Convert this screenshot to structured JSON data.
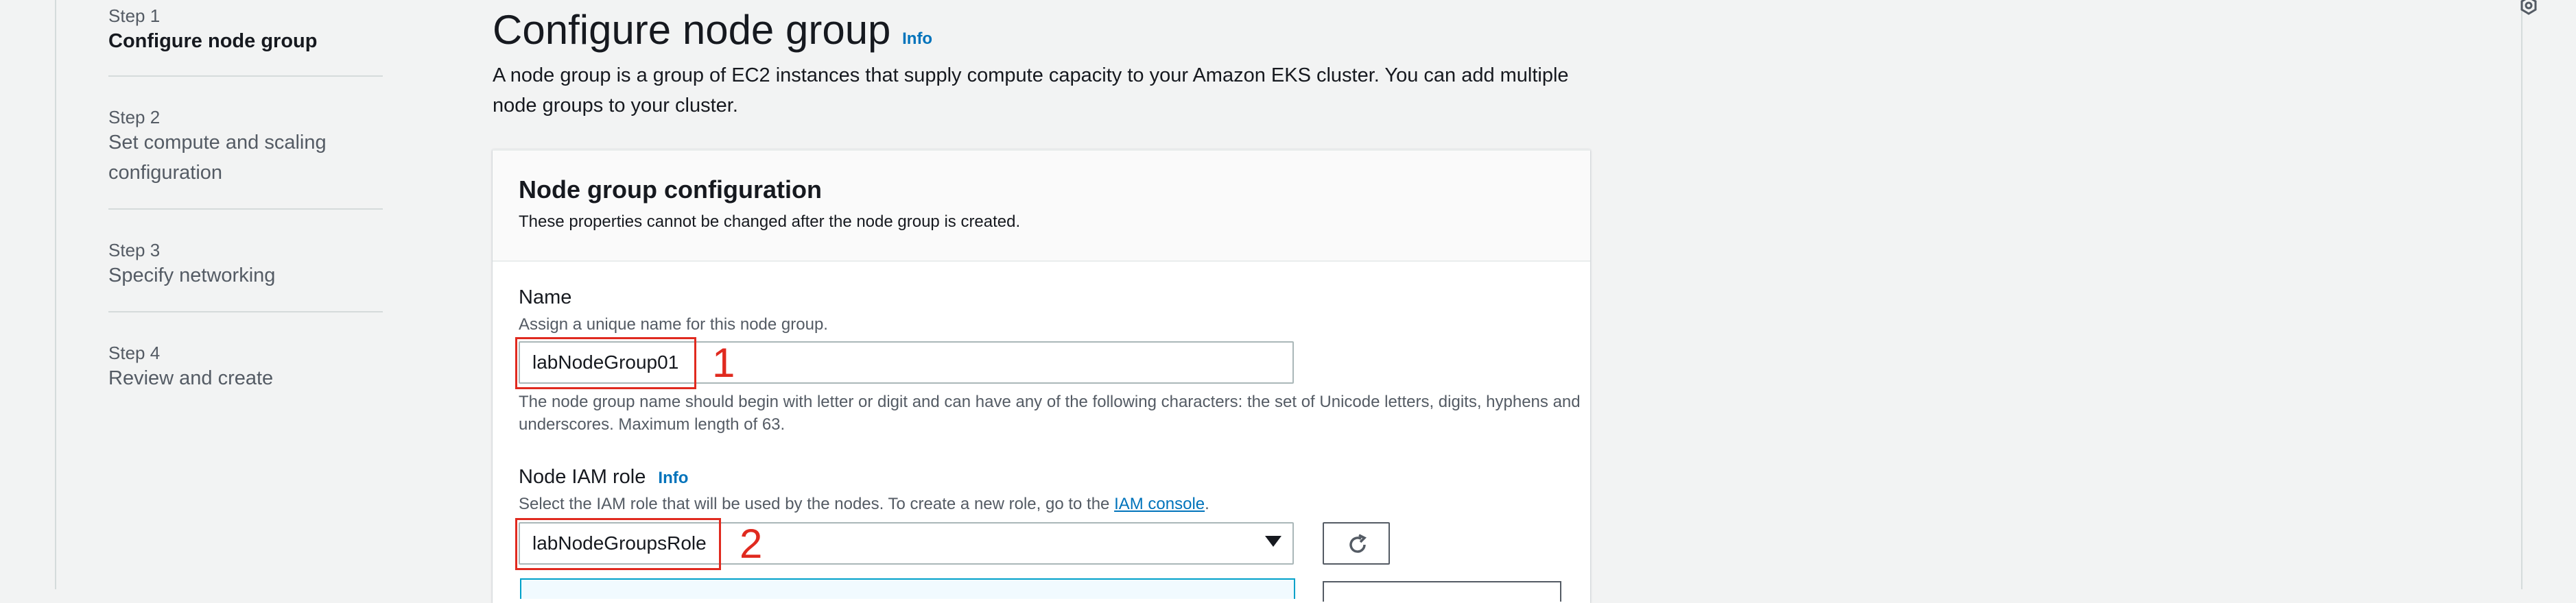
{
  "steps": [
    {
      "number": "Step 1",
      "title": "Configure node group"
    },
    {
      "number": "Step 2",
      "title": "Set compute and scaling configuration"
    },
    {
      "number": "Step 3",
      "title": "Specify networking"
    },
    {
      "number": "Step 4",
      "title": "Review and create"
    }
  ],
  "page": {
    "title": "Configure node group",
    "info": "Info",
    "description": "A node group is a group of EC2 instances that supply compute capacity to your Amazon EKS cluster. You can add multiple node groups to your cluster."
  },
  "panel": {
    "title": "Node group configuration",
    "description": "These properties cannot be changed after the node group is created."
  },
  "name_field": {
    "label": "Name",
    "description": "Assign a unique name for this node group.",
    "value": "labNodeGroup01",
    "constraint": "The node group name should begin with letter or digit and can have any of the following characters: the set of Unicode letters, digits, hyphens and underscores. Maximum length of 63."
  },
  "role_field": {
    "label": "Node IAM role",
    "info": "Info",
    "description_prefix": "Select the IAM role that will be used by the nodes. To create a new role, go to the ",
    "link": "IAM console",
    "description_suffix": ".",
    "value": "labNodeGroupsRole"
  },
  "annotations": [
    "1",
    "2"
  ],
  "colors": {
    "accent": "#0073bb",
    "annotation": "#e02a1f",
    "background": "#f2f3f3"
  },
  "icons": {
    "refresh": "refresh-icon",
    "dropdown": "caret-down-icon"
  }
}
